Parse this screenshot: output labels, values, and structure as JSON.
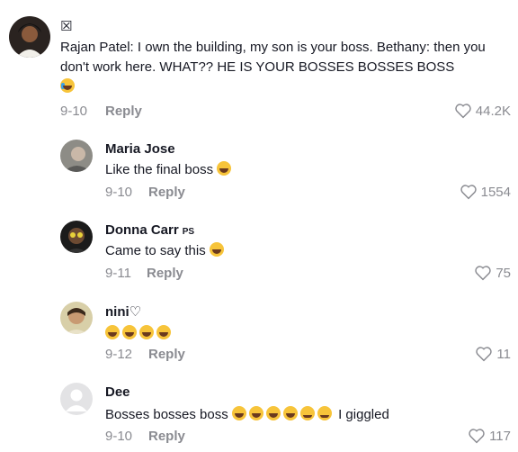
{
  "comments": [
    {
      "author": "☒",
      "text": "Rajan Patel: I own the building, my son is your boss. Bethany: then you don't work here. WHAT?? HE IS YOUR BOSSES BOSSES BOSS",
      "date": "9-10",
      "reply_label": "Reply",
      "likes": "44.2K"
    },
    {
      "author": "Maria Jose",
      "text": "Like the final boss",
      "date": "9-10",
      "reply_label": "Reply",
      "likes": "1554"
    },
    {
      "author": "Donna Carr",
      "badge": "PS",
      "text": "Came to say this",
      "date": "9-11",
      "reply_label": "Reply",
      "likes": "75"
    },
    {
      "author": "nini♡",
      "text": "",
      "date": "9-12",
      "reply_label": "Reply",
      "likes": "11"
    },
    {
      "author": "Dee",
      "text": "Bosses bosses boss",
      "text_after": "I giggled",
      "date": "9-10",
      "reply_label": "Reply",
      "likes": "117"
    }
  ],
  "colors": {
    "text": "#161823",
    "muted": "#8a8b91",
    "emoji": "#f7c43a"
  },
  "icons": {
    "like": "heart-outline-icon",
    "emoji": "laughing-emoji-icon"
  }
}
